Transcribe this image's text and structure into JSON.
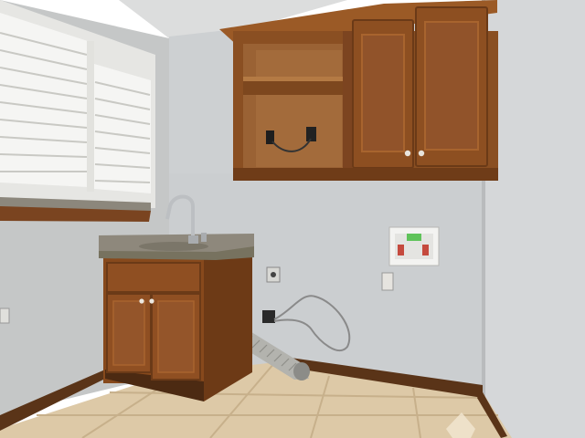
{
  "scene": {
    "description_alt": "",
    "colors": {
      "wall_left": "#c6c8c8",
      "wall_back": "#cdd0d2",
      "wall_right": "#d4d6d8",
      "ceiling": "#dcdddd",
      "cabinet_wood": "#8a4f22",
      "cabinet_wood_dark": "#6b3a17",
      "cabinet_wood_light": "#a8642e",
      "countertop": "#8d877b",
      "baseboard": "#5a3418",
      "floor": "#dcc9a8",
      "floor_grout": "#c8b18c",
      "shutter": "#f4f4f2",
      "window_trim": "#e9e9e6",
      "washer_box": "#f3f3f1",
      "faucet": "#b9bcbf",
      "dryer_duct": "#b2b2ae"
    }
  }
}
